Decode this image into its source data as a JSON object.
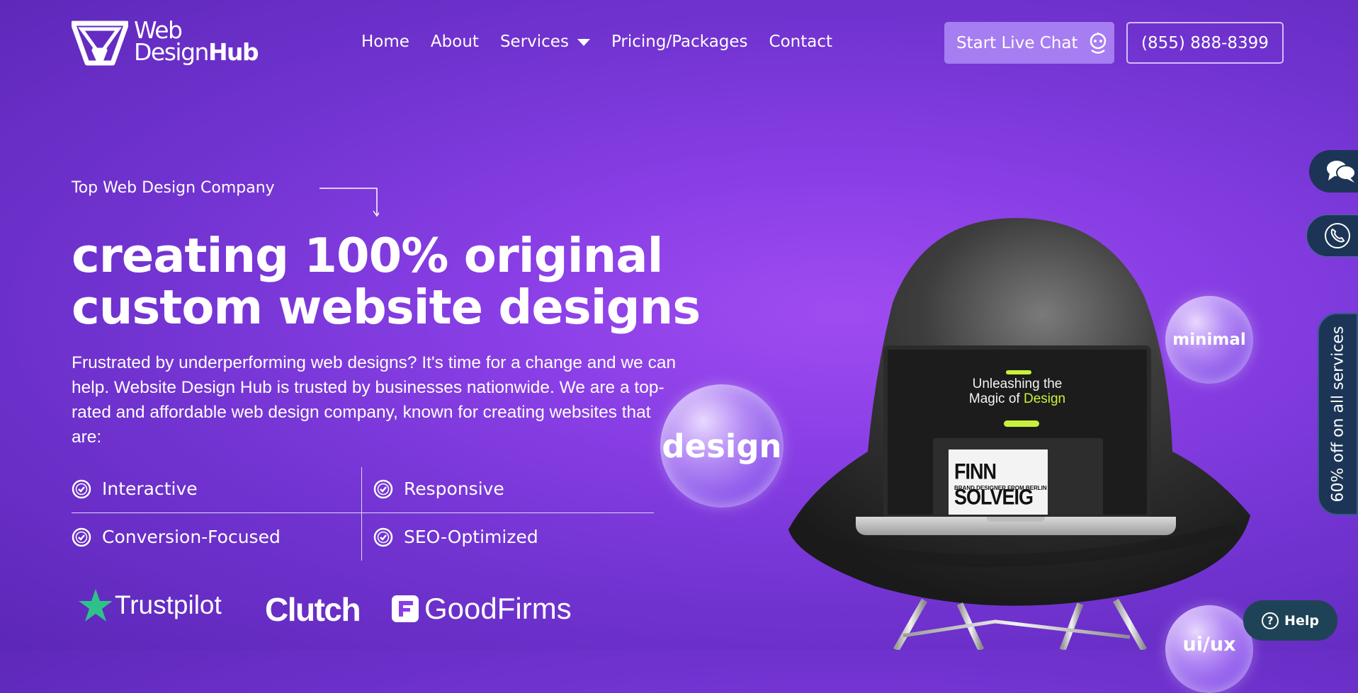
{
  "brand": {
    "logo_line1": "Web",
    "logo_line2_regular": "Design",
    "logo_line2_bold": "Hub"
  },
  "nav": {
    "home": "Home",
    "about": "About",
    "services": "Services",
    "pricing": "Pricing/Packages",
    "contact": "Contact"
  },
  "header": {
    "chat_label": "Start Live Chat",
    "phone": "(855) 888-8399"
  },
  "hero": {
    "eyebrow": "Top Web Design Company",
    "headline_line1": "creating 100% original",
    "headline_line2": "custom website designs",
    "description": "Frustrated by underperforming web designs? It's time for a change and we can help. Website Design Hub is trusted by businesses nationwide. We are a top-rated and affordable web design company, known for creating websites that are:",
    "features": [
      "Interactive",
      "Responsive",
      "Conversion-Focused",
      "SEO-Optimized"
    ]
  },
  "badges": {
    "trustpilot": "Trustpilot",
    "clutch": "Clutch",
    "goodfirms": "GoodFirms"
  },
  "bubbles": {
    "design": "design",
    "minimal": "minimal",
    "uiux": "ui/ux"
  },
  "laptop_screen": {
    "title_line1": "Unleashing the",
    "title_line2_prefix": "Magic of ",
    "title_line2_highlight": "Design",
    "finn": "FINN SOLVEIG",
    "finn_sub": "BRAND DESIGNER FROM BERLIN"
  },
  "side": {
    "offer": "60% off on all services",
    "help": "Help"
  },
  "colors": {
    "accent_purple": "#8a3fe6",
    "chat_button": "#a77df2",
    "widget_navy": "#1c3556",
    "screen_green": "#c8f23a"
  }
}
